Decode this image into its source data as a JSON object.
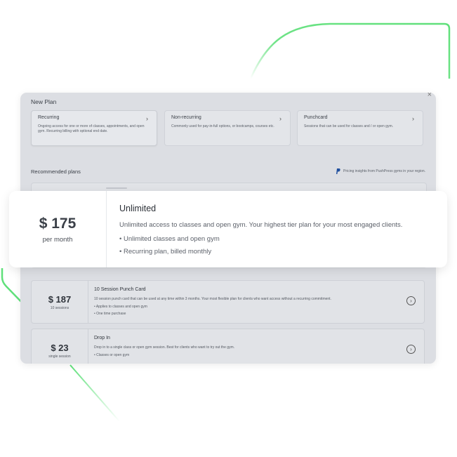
{
  "colors": {
    "accent_green": "#5fe07a",
    "panel_bg": "#dcdee3",
    "card_bg": "#ffffff"
  },
  "new_plan": {
    "title": "New Plan",
    "close_icon": "close-icon",
    "types": [
      {
        "label": "Recurring",
        "description": "Ongoing access for one or more of classes, appointments, and open gym. Recurring billing with optional end date."
      },
      {
        "label": "Non-recurring",
        "description": "Commonly used for pay-in-full options, or bootcamps, courses etc."
      },
      {
        "label": "Punchcard",
        "description": "Sessions that can be used for classes and / or open gym."
      }
    ]
  },
  "recommended": {
    "title": "Recommended plans",
    "insights": "Pricing insights from PushPress gyms in your region.",
    "insights_icon": "paypal-icon"
  },
  "featured_plan": {
    "price": "$ 175",
    "period": "per month",
    "name": "Unlimited",
    "description": "Unlimited access to classes and open gym. Your highest tier plan for your most engaged clients.",
    "bullets": [
      "Unlimited classes and open gym",
      "Recurring plan, billed monthly"
    ]
  },
  "plans": [
    {
      "price": "$ 187",
      "period": "10 sessions",
      "name": "10 Session Punch Card",
      "description": "10 session punch card that can be used at any time within 3 months. Your most flexible plan for clients who want access without a recurring commitment.",
      "bullets": [
        "Applies to classes and open gym",
        "One time purchase"
      ]
    },
    {
      "price": "$ 23",
      "period": "single session",
      "name": "Drop In",
      "description": "Drop in to a single class or open gym session. Best for clients who want to try out the gym.",
      "bullets": [
        "Classes or open gym"
      ]
    }
  ]
}
